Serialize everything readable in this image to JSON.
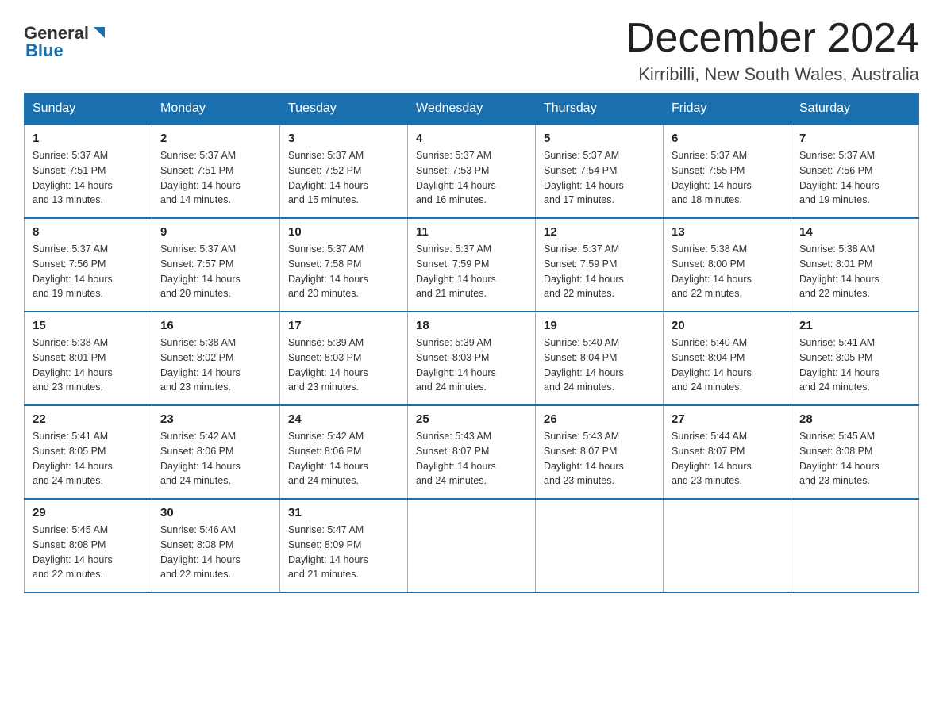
{
  "header": {
    "logo_general": "General",
    "logo_blue": "Blue",
    "month_title": "December 2024",
    "location": "Kirribilli, New South Wales, Australia"
  },
  "weekdays": [
    "Sunday",
    "Monday",
    "Tuesday",
    "Wednesday",
    "Thursday",
    "Friday",
    "Saturday"
  ],
  "weeks": [
    [
      {
        "day": "1",
        "sunrise": "5:37 AM",
        "sunset": "7:51 PM",
        "daylight": "14 hours and 13 minutes."
      },
      {
        "day": "2",
        "sunrise": "5:37 AM",
        "sunset": "7:51 PM",
        "daylight": "14 hours and 14 minutes."
      },
      {
        "day": "3",
        "sunrise": "5:37 AM",
        "sunset": "7:52 PM",
        "daylight": "14 hours and 15 minutes."
      },
      {
        "day": "4",
        "sunrise": "5:37 AM",
        "sunset": "7:53 PM",
        "daylight": "14 hours and 16 minutes."
      },
      {
        "day": "5",
        "sunrise": "5:37 AM",
        "sunset": "7:54 PM",
        "daylight": "14 hours and 17 minutes."
      },
      {
        "day": "6",
        "sunrise": "5:37 AM",
        "sunset": "7:55 PM",
        "daylight": "14 hours and 18 minutes."
      },
      {
        "day": "7",
        "sunrise": "5:37 AM",
        "sunset": "7:56 PM",
        "daylight": "14 hours and 19 minutes."
      }
    ],
    [
      {
        "day": "8",
        "sunrise": "5:37 AM",
        "sunset": "7:56 PM",
        "daylight": "14 hours and 19 minutes."
      },
      {
        "day": "9",
        "sunrise": "5:37 AM",
        "sunset": "7:57 PM",
        "daylight": "14 hours and 20 minutes."
      },
      {
        "day": "10",
        "sunrise": "5:37 AM",
        "sunset": "7:58 PM",
        "daylight": "14 hours and 20 minutes."
      },
      {
        "day": "11",
        "sunrise": "5:37 AM",
        "sunset": "7:59 PM",
        "daylight": "14 hours and 21 minutes."
      },
      {
        "day": "12",
        "sunrise": "5:37 AM",
        "sunset": "7:59 PM",
        "daylight": "14 hours and 22 minutes."
      },
      {
        "day": "13",
        "sunrise": "5:38 AM",
        "sunset": "8:00 PM",
        "daylight": "14 hours and 22 minutes."
      },
      {
        "day": "14",
        "sunrise": "5:38 AM",
        "sunset": "8:01 PM",
        "daylight": "14 hours and 22 minutes."
      }
    ],
    [
      {
        "day": "15",
        "sunrise": "5:38 AM",
        "sunset": "8:01 PM",
        "daylight": "14 hours and 23 minutes."
      },
      {
        "day": "16",
        "sunrise": "5:38 AM",
        "sunset": "8:02 PM",
        "daylight": "14 hours and 23 minutes."
      },
      {
        "day": "17",
        "sunrise": "5:39 AM",
        "sunset": "8:03 PM",
        "daylight": "14 hours and 23 minutes."
      },
      {
        "day": "18",
        "sunrise": "5:39 AM",
        "sunset": "8:03 PM",
        "daylight": "14 hours and 24 minutes."
      },
      {
        "day": "19",
        "sunrise": "5:40 AM",
        "sunset": "8:04 PM",
        "daylight": "14 hours and 24 minutes."
      },
      {
        "day": "20",
        "sunrise": "5:40 AM",
        "sunset": "8:04 PM",
        "daylight": "14 hours and 24 minutes."
      },
      {
        "day": "21",
        "sunrise": "5:41 AM",
        "sunset": "8:05 PM",
        "daylight": "14 hours and 24 minutes."
      }
    ],
    [
      {
        "day": "22",
        "sunrise": "5:41 AM",
        "sunset": "8:05 PM",
        "daylight": "14 hours and 24 minutes."
      },
      {
        "day": "23",
        "sunrise": "5:42 AM",
        "sunset": "8:06 PM",
        "daylight": "14 hours and 24 minutes."
      },
      {
        "day": "24",
        "sunrise": "5:42 AM",
        "sunset": "8:06 PM",
        "daylight": "14 hours and 24 minutes."
      },
      {
        "day": "25",
        "sunrise": "5:43 AM",
        "sunset": "8:07 PM",
        "daylight": "14 hours and 24 minutes."
      },
      {
        "day": "26",
        "sunrise": "5:43 AM",
        "sunset": "8:07 PM",
        "daylight": "14 hours and 23 minutes."
      },
      {
        "day": "27",
        "sunrise": "5:44 AM",
        "sunset": "8:07 PM",
        "daylight": "14 hours and 23 minutes."
      },
      {
        "day": "28",
        "sunrise": "5:45 AM",
        "sunset": "8:08 PM",
        "daylight": "14 hours and 23 minutes."
      }
    ],
    [
      {
        "day": "29",
        "sunrise": "5:45 AM",
        "sunset": "8:08 PM",
        "daylight": "14 hours and 22 minutes."
      },
      {
        "day": "30",
        "sunrise": "5:46 AM",
        "sunset": "8:08 PM",
        "daylight": "14 hours and 22 minutes."
      },
      {
        "day": "31",
        "sunrise": "5:47 AM",
        "sunset": "8:09 PM",
        "daylight": "14 hours and 21 minutes."
      },
      null,
      null,
      null,
      null
    ]
  ],
  "labels": {
    "sunrise": "Sunrise:",
    "sunset": "Sunset:",
    "daylight": "Daylight:"
  }
}
